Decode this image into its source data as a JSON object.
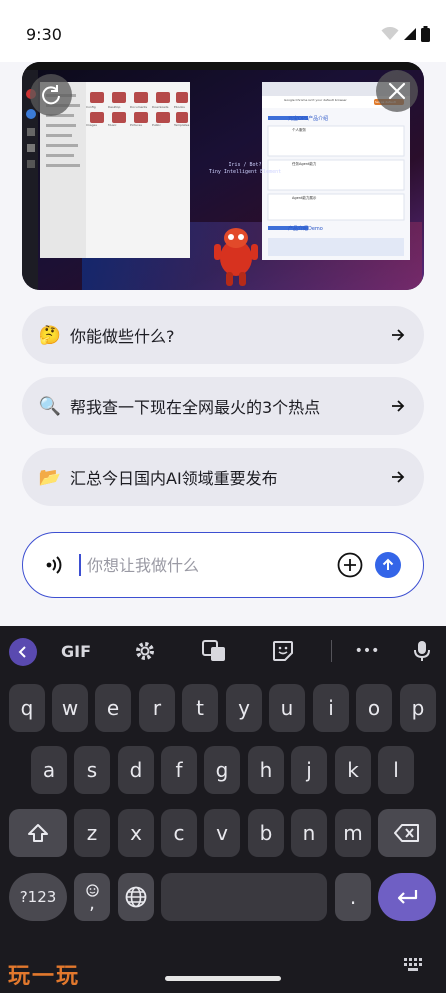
{
  "status": {
    "time": "9:30"
  },
  "preview": {
    "folder_labels": [
      "Config",
      "Desktop",
      "Documents",
      "Downloads",
      "Ebooks",
      "Images",
      "Music",
      "Pictures",
      "Public",
      "Templates"
    ],
    "center_text_1": "Iris / Bot?",
    "center_text_2": "Tiny Intelligent Element",
    "browser_banner": "Google Chrome isn't your default browser",
    "browser_banner_button": "Set as default",
    "browser_heading": "元宝OPS产品介绍",
    "browser_footer": "产品介绍Demo",
    "browser_card_titles": [
      "个人服务",
      "任务Agent能力",
      "Agent能力展示"
    ]
  },
  "suggestions": [
    {
      "emoji": "🤔",
      "icon": "thinking-face-icon",
      "text": "你能做些什么?"
    },
    {
      "emoji": "🔍",
      "icon": "magnifier-icon",
      "text": "帮我查一下现在全网最火的3个热点"
    },
    {
      "emoji": "📂",
      "icon": "folder-icon",
      "text": "汇总今日国内AI领域重要发布"
    }
  ],
  "input": {
    "placeholder": "你想让我做什么"
  },
  "keyboard": {
    "toolbar": {
      "gif": "GIF",
      "more": "•••"
    },
    "row1": [
      "q",
      "w",
      "e",
      "r",
      "t",
      "y",
      "u",
      "i",
      "o",
      "p"
    ],
    "row2": [
      "a",
      "s",
      "d",
      "f",
      "g",
      "h",
      "j",
      "k",
      "l"
    ],
    "row3": [
      "z",
      "x",
      "c",
      "v",
      "b",
      "n",
      "m"
    ],
    "symbols": "?123",
    "emoji_comma": ",",
    "period": "."
  },
  "watermark": "玩一玩",
  "colors": {
    "accent": "#3d4fd1",
    "send": "#3465e8",
    "enter": "#6f5fc4",
    "watermark": "#e2782d"
  }
}
